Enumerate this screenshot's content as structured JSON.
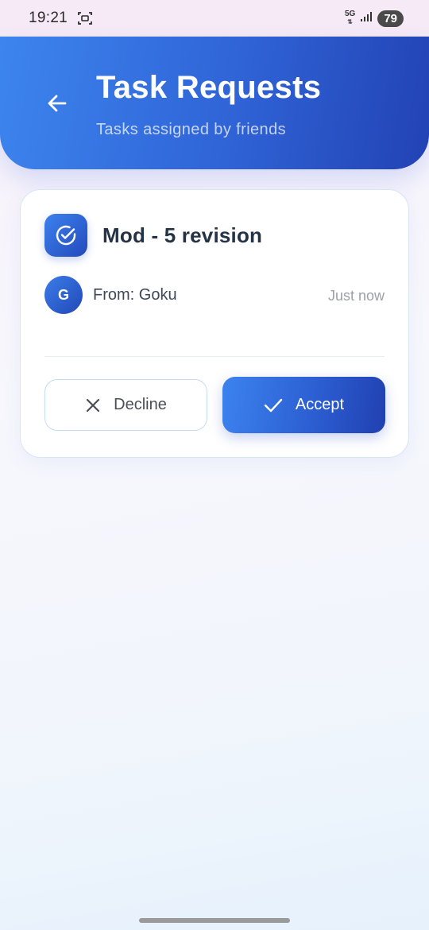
{
  "status_bar": {
    "time": "19:21",
    "network": "5G",
    "battery": "79",
    "icons": [
      "screen-record-icon",
      "signal-icon",
      "battery-icon"
    ]
  },
  "header": {
    "back_icon": "arrow-left-icon",
    "title": "Task Requests",
    "subtitle": "Tasks assigned by friends"
  },
  "task_request": {
    "icon": "check-circle-icon",
    "title": "Mod - 5 revision",
    "sender_initial": "G",
    "from": "From: Goku",
    "time": "Just now",
    "decline_label": "Decline",
    "decline_icon": "close-icon",
    "accept_label": "Accept",
    "accept_icon": "checkmark-icon"
  },
  "colors": {
    "accent_start": "#3d85ee",
    "accent_end": "#2242b4",
    "title_text": "#253347",
    "muted_text": "#9aa0a8"
  }
}
